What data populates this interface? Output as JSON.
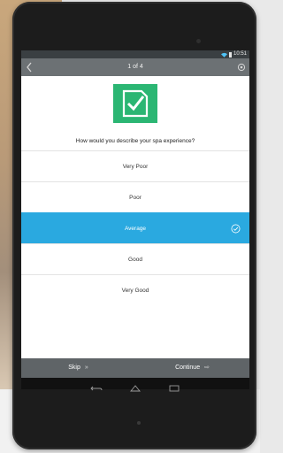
{
  "status_bar": {
    "time": "10:51"
  },
  "header": {
    "progress": "1 of 4"
  },
  "survey": {
    "question": "How would you describe your spa experience?"
  },
  "options": [
    {
      "label": "Very Poor",
      "selected": false
    },
    {
      "label": "Poor",
      "selected": false
    },
    {
      "label": "Average",
      "selected": true
    },
    {
      "label": "Good",
      "selected": false
    },
    {
      "label": "Very Good",
      "selected": false
    }
  ],
  "footer": {
    "skip_label": "Skip",
    "continue_label": "Continue"
  },
  "colors": {
    "accent": "#2aa9e0",
    "logo": "#2bb673",
    "bar": "#5f6467"
  },
  "icons": [
    "back-icon",
    "settings-icon",
    "check-icon",
    "wifi-icon",
    "battery-icon",
    "back-nav-icon",
    "home-nav-icon",
    "recents-nav-icon"
  ]
}
